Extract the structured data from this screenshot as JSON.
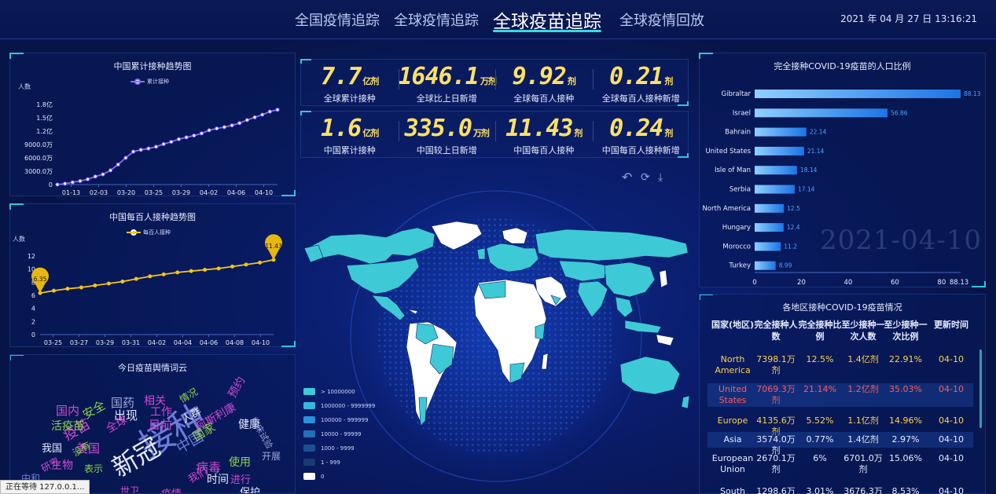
{
  "header": {
    "nav": [
      {
        "label": "全国疫情追踪"
      },
      {
        "label": "全球疫情追踪"
      },
      {
        "label": "全球疫苗追踪"
      },
      {
        "label": "全球疫情回放"
      }
    ],
    "active_index": 2,
    "datetime": "2021 年 04 月 27 日 13:16:21"
  },
  "colors": {
    "accent": "#2fc7d9",
    "gold": "#ffe066",
    "purple": "#8b6cff",
    "yellow_series": "#f5c518",
    "bar": "#2d8ff0",
    "highlight_row": "#ffd24a",
    "red_row": "#ff5a5a"
  },
  "panels": {
    "china_cumulative": {
      "title": "中国累计接种趋势图",
      "legend": "累计接种",
      "ylabel": "人数"
    },
    "china_per_hundred": {
      "title": "中国每百人接种趋势图",
      "legend": "每百人接种",
      "ylabel": "人数",
      "marker_start": "6.35",
      "marker_end": "11.43"
    },
    "word_cloud": {
      "title": "今日疫苗舆情词云",
      "words": [
        {
          "text": "接种",
          "size": 44,
          "color": "#6e7bd8",
          "rot": -30
        },
        {
          "text": "新冠",
          "size": 32,
          "color": "#e6ecff",
          "rot": -30
        },
        {
          "text": "疫苗",
          "size": 18,
          "color": "#d04ad0",
          "rot": -30
        },
        {
          "text": "国药",
          "size": 15,
          "color": "#9fa7d8",
          "rot": 0
        },
        {
          "text": "相关",
          "size": 14,
          "color": "#d04ad0",
          "rot": 0
        },
        {
          "text": "情况",
          "size": 12,
          "color": "#8fd34a",
          "rot": -30
        },
        {
          "text": "国内",
          "size": 15,
          "color": "#d04ad0",
          "rot": 0
        },
        {
          "text": "安全",
          "size": 15,
          "color": "#8fd34a",
          "rot": -30
        },
        {
          "text": "出现",
          "size": 15,
          "color": "#e6ecff",
          "rot": 0
        },
        {
          "text": "工作",
          "size": 14,
          "color": "#d04ad0",
          "rot": 0
        },
        {
          "text": "预约",
          "size": 14,
          "color": "#d04ad0",
          "rot": -60
        },
        {
          "text": "活疫苗",
          "size": 14,
          "color": "#8fd34a",
          "rot": 0
        },
        {
          "text": "目前",
          "size": 15,
          "color": "#d04ad0",
          "rot": 0
        },
        {
          "text": "人群",
          "size": 13,
          "color": "#e6ecff",
          "rot": -30
        },
        {
          "text": "阿斯利康",
          "size": 14,
          "color": "#d04ad0",
          "rot": -30
        },
        {
          "text": "全球",
          "size": 14,
          "color": "#d04ad0",
          "rot": -30
        },
        {
          "text": "健康",
          "size": 14,
          "color": "#e6ecff",
          "rot": 0
        },
        {
          "text": "临床试验",
          "size": 11,
          "color": "#9fa7d8",
          "rot": 60
        },
        {
          "text": "我国",
          "size": 13,
          "color": "#e6ecff",
          "rot": 0
        },
        {
          "text": "美国",
          "size": 15,
          "color": "#d04ad0",
          "rot": 0
        },
        {
          "text": "中国",
          "size": 18,
          "color": "#6e7bd8",
          "rot": -30
        },
        {
          "text": "国家",
          "size": 15,
          "color": "#8fd34a",
          "rot": -30
        },
        {
          "text": "病毒",
          "size": 16,
          "color": "#d04ad0",
          "rot": 0
        },
        {
          "text": "使用",
          "size": 14,
          "color": "#8fd34a",
          "rot": 0
        },
        {
          "text": "生物",
          "size": 14,
          "color": "#d04ad0",
          "rot": 0
        },
        {
          "text": "没有",
          "size": 12,
          "color": "#8fd34a",
          "rot": -30
        },
        {
          "text": "表示",
          "size": 12,
          "color": "#8fd34a",
          "rot": 0
        },
        {
          "text": "时间",
          "size": 14,
          "color": "#e6ecff",
          "rot": 0
        },
        {
          "text": "进行",
          "size": 13,
          "color": "#d04ad0",
          "rot": 0
        },
        {
          "text": "我们",
          "size": 13,
          "color": "#d04ad0",
          "rot": -30
        },
        {
          "text": "疫情",
          "size": 13,
          "color": "#d04ad0",
          "rot": 0
        },
        {
          "text": "保护",
          "size": 13,
          "color": "#e6ecff",
          "rot": 0
        },
        {
          "text": "研究",
          "size": 12,
          "color": "#d04ad0",
          "rot": -30
        },
        {
          "text": "中和",
          "size": 12,
          "color": "#6e7bd8",
          "rot": 0
        },
        {
          "text": "开展",
          "size": 12,
          "color": "#9fa7d8",
          "rot": 0
        },
        {
          "text": "世卫",
          "size": 12,
          "color": "#d04ad0",
          "rot": 0
        }
      ]
    },
    "completion_ratio": {
      "title": "完全接种COVID-19疫苗的人口比例",
      "watermark": "2021-04-10"
    },
    "region_table": {
      "title": "各地区接种COVID-19疫苗情况",
      "headers": [
        "国家(地区)",
        "完全接种人数",
        "完全接种比例",
        "至少接种一次人数",
        "至少接种一次比例",
        "更新时间"
      ],
      "rows": [
        {
          "region": "North America",
          "full": "7398.1万剂",
          "full_pct": "12.5%",
          "once": "1.4亿剂",
          "once_pct": "22.91%",
          "date": "04-10",
          "style": "gold"
        },
        {
          "region": "United States",
          "full": "7069.3万剂",
          "full_pct": "21.14%",
          "once": "1.2亿剂",
          "once_pct": "35.03%",
          "date": "04-10",
          "style": "red"
        },
        {
          "region": "Europe",
          "full": "4135.6万剂",
          "full_pct": "5.52%",
          "once": "1.1亿剂",
          "once_pct": "14.96%",
          "date": "04-10",
          "style": "gold"
        },
        {
          "region": "Asia",
          "full": "3574.0万剂",
          "full_pct": "0.77%",
          "once": "1.4亿剂",
          "once_pct": "2.97%",
          "date": "04-10",
          "style": "white"
        },
        {
          "region": "European Union",
          "full": "2670.1万剂",
          "full_pct": "6%",
          "once": "6701.0万剂",
          "once_pct": "15.06%",
          "date": "04-10",
          "style": "white"
        },
        {
          "region": "South",
          "full": "1298.6万剂",
          "full_pct": "3.01%",
          "once": "3676.3万剂",
          "once_pct": "8.53%",
          "date": "04-10",
          "style": "white"
        }
      ]
    }
  },
  "stats_global": [
    {
      "value": "7.7",
      "unit": "亿剂",
      "label": "全球累计接种"
    },
    {
      "value": "1646.1",
      "unit": "万剂",
      "label": "全球比上日新增"
    },
    {
      "value": "9.92",
      "unit": "剂",
      "label": "全球每百人接种"
    },
    {
      "value": "0.21",
      "unit": "剂",
      "label": "全球每百人接种新增"
    }
  ],
  "stats_china": [
    {
      "value": "1.6",
      "unit": "亿剂",
      "label": "中国累计接种"
    },
    {
      "value": "335.0",
      "unit": "万剂",
      "label": "中国较上日新增"
    },
    {
      "value": "11.43",
      "unit": "剂",
      "label": "中国每百人接种"
    },
    {
      "value": "0.24",
      "unit": "剂",
      "label": "中国每百人接种新增"
    }
  ],
  "map": {
    "legend": [
      {
        "label": "> 10000000",
        "color": "#3ec9d6"
      },
      {
        "label": "1000000 - 9999999",
        "color": "#38b8e0"
      },
      {
        "label": "100000 - 999999",
        "color": "#2a93d8"
      },
      {
        "label": "10000 - 99999",
        "color": "#2370b8"
      },
      {
        "label": "1000 - 9999",
        "color": "#1d4f93"
      },
      {
        "label": "1 - 999",
        "color": "#1a3a73"
      },
      {
        "label": "0",
        "color": "#ffffff"
      }
    ],
    "toolbox": [
      "restore-icon",
      "refresh-icon",
      "download-icon"
    ]
  },
  "status_tip": "正在等待 127.0.0.1...",
  "chart_data": [
    {
      "type": "line",
      "title": "中国累计接种趋势图",
      "ylabel": "人数",
      "series": [
        {
          "name": "累计接种",
          "values": [
            0,
            200,
            500,
            800,
            1200,
            1800,
            2300,
            3200,
            4500,
            6000,
            7400,
            7800,
            8100,
            8500,
            9100,
            9600,
            10200,
            10600,
            11000,
            11500,
            12200,
            12600,
            12900,
            13300,
            13800,
            14500,
            15100,
            15700,
            16400,
            16800
          ]
        }
      ],
      "x_ticks": [
        "01-13",
        "02-03",
        "03-20",
        "03-25",
        "03-29",
        "04-02",
        "04-06",
        "04-10"
      ],
      "y_ticks": [
        "0",
        "3000.0万",
        "6000.0万",
        "9000.0万",
        "1.2亿",
        "1.5亿",
        "1.8亿"
      ],
      "ylim": [
        0,
        18000
      ]
    },
    {
      "type": "line",
      "title": "中国每百人接种趋势图",
      "ylabel": "人数",
      "series": [
        {
          "name": "每百人接种",
          "values": [
            6.35,
            6.7,
            7.0,
            7.2,
            7.5,
            7.8,
            8.1,
            8.5,
            8.9,
            9.2,
            9.5,
            9.7,
            9.9,
            10.1,
            10.4,
            10.7,
            11.0,
            11.43
          ]
        }
      ],
      "x_ticks": [
        "03-25",
        "03-27",
        "03-29",
        "03-31",
        "04-02",
        "04-04",
        "04-06",
        "04-08",
        "04-10"
      ],
      "y_ticks": [
        "0",
        "2",
        "4",
        "6",
        "8",
        "10",
        "12"
      ],
      "ylim": [
        0,
        12
      ]
    },
    {
      "type": "bar",
      "title": "完全接种COVID-19疫苗的人口比例",
      "orientation": "horizontal",
      "categories": [
        "Gibraltar",
        "Israel",
        "Bahrain",
        "United States",
        "Isle of Man",
        "Serbia",
        "North America",
        "Hungary",
        "Morocco",
        "Turkey"
      ],
      "values": [
        88.13,
        56.86,
        22.14,
        21.14,
        18.14,
        17.14,
        12.5,
        12.4,
        11.2,
        8.99
      ],
      "x_ticks": [
        "0",
        "20",
        "40",
        "60",
        "80",
        "88.13"
      ],
      "xlim": [
        0,
        88.13
      ]
    }
  ]
}
